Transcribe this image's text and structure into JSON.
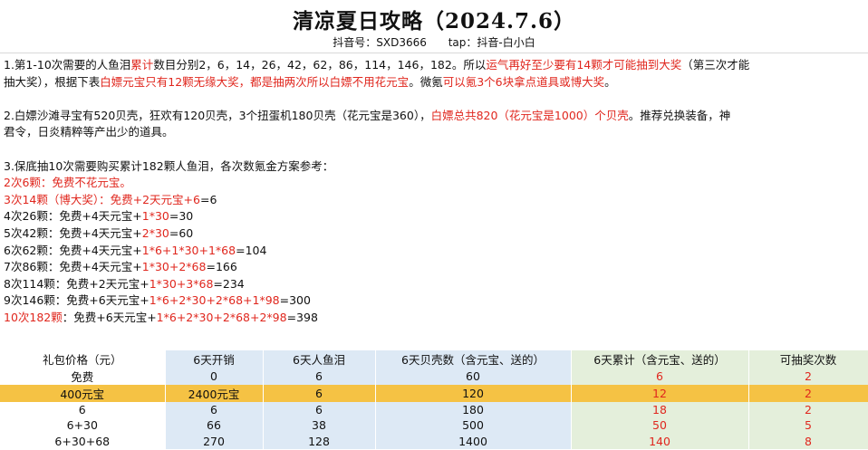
{
  "header": {
    "title": "清凉夏日攻略（2024.7.6）",
    "douyin": "抖音号：SXD3666",
    "tap": "tap：抖音-白小白"
  },
  "notes": {
    "p1": [
      [
        {
          "t": "1.第1-10次需要的人鱼泪",
          "red": false
        },
        {
          "t": "累计",
          "red": true
        },
        {
          "t": "数目分别2，6，14，26，42，62，86，114，146，182。所以",
          "red": false
        },
        {
          "t": "运气再好至少要有14颗才可能抽到大奖",
          "red": true
        },
        {
          "t": "（第三次才能",
          "red": false
        }
      ],
      [
        {
          "t": "抽大奖），根据下表",
          "red": false
        },
        {
          "t": "白嫖元宝只有12颗无缘大奖，都是抽两次所以白嫖不用花元宝",
          "red": true
        },
        {
          "t": "。微氪",
          "red": false
        },
        {
          "t": "可以氪3个6块拿点道具或博大奖",
          "red": true
        },
        {
          "t": "。",
          "red": false
        }
      ]
    ],
    "p2": [
      [
        {
          "t": "2.白嫖沙滩寻宝有520贝壳，狂欢有120贝壳，3个扭蛋机180贝壳（花元宝是360），",
          "red": false
        },
        {
          "t": "白嫖总共820（花元宝是1000）个贝壳",
          "red": true
        },
        {
          "t": "。推荐兑换装备，神",
          "red": false
        }
      ],
      [
        {
          "t": "君令，日炎精粹等产出少的道具。",
          "red": false
        }
      ]
    ],
    "p3": [
      [
        {
          "t": "3.保底抽10次需要购买累计182颗人鱼泪，各次数氪金方案参考：",
          "red": false
        }
      ],
      [
        {
          "t": "2次6颗：免费不花元宝。",
          "red": true
        }
      ],
      [
        {
          "t": "3次14颗（博大奖）：免费+2天元宝+6",
          "red": true
        },
        {
          "t": "=6",
          "red": false
        }
      ],
      [
        {
          "t": "4次26颗：免费+4天元宝+",
          "red": false
        },
        {
          "t": "1*30",
          "red": true
        },
        {
          "t": "=30",
          "red": false
        }
      ],
      [
        {
          "t": "5次42颗：免费+4天元宝+",
          "red": false
        },
        {
          "t": "2*30",
          "red": true
        },
        {
          "t": "=60",
          "red": false
        }
      ],
      [
        {
          "t": "6次62颗：免费+4天元宝+",
          "red": false
        },
        {
          "t": "1*6+1*30+1*68",
          "red": true
        },
        {
          "t": "=104",
          "red": false
        }
      ],
      [
        {
          "t": "7次86颗：免费+4天元宝+",
          "red": false
        },
        {
          "t": "1*30+2*68",
          "red": true
        },
        {
          "t": "=166",
          "red": false
        }
      ],
      [
        {
          "t": "8次114颗：免费+2天元宝+",
          "red": false
        },
        {
          "t": "1*30+3*68",
          "red": true
        },
        {
          "t": "=234",
          "red": false
        }
      ],
      [
        {
          "t": "9次146颗：免费+6天元宝+",
          "red": false
        },
        {
          "t": "1*6+2*30+2*68+1*98",
          "red": true
        },
        {
          "t": "=300",
          "red": false
        }
      ],
      [
        {
          "t": "10次182颗",
          "red": true
        },
        {
          "t": "：免费+6天元宝+",
          "red": false
        },
        {
          "t": "1*6+2*30+2*68+2*98",
          "red": true
        },
        {
          "t": "=398",
          "red": false
        }
      ]
    ]
  },
  "table": {
    "headers": [
      "礼包价格（元）",
      "6天开销",
      "6天人鱼泪",
      "6天贝壳数（含元宝、送的）",
      "6天累计（含元宝、送的）",
      "可抽奖次数"
    ],
    "rows": [
      [
        "免费",
        "0",
        "6",
        "60",
        "6",
        "2"
      ],
      [
        "400元宝",
        "2400元宝",
        "6",
        "120",
        "12",
        "2"
      ],
      [
        "6",
        "6",
        "6",
        "180",
        "18",
        "2"
      ],
      [
        "6+30",
        "66",
        "38",
        "500",
        "50",
        "5"
      ],
      [
        "6+30+68",
        "270",
        "128",
        "1400",
        "140",
        "8"
      ]
    ],
    "highlight_row": 1
  },
  "colors": {
    "accent_red": "#e0271e",
    "highlight": "#f5c244",
    "blue_band": "#dde9f5",
    "green_band": "#e4efdb"
  }
}
